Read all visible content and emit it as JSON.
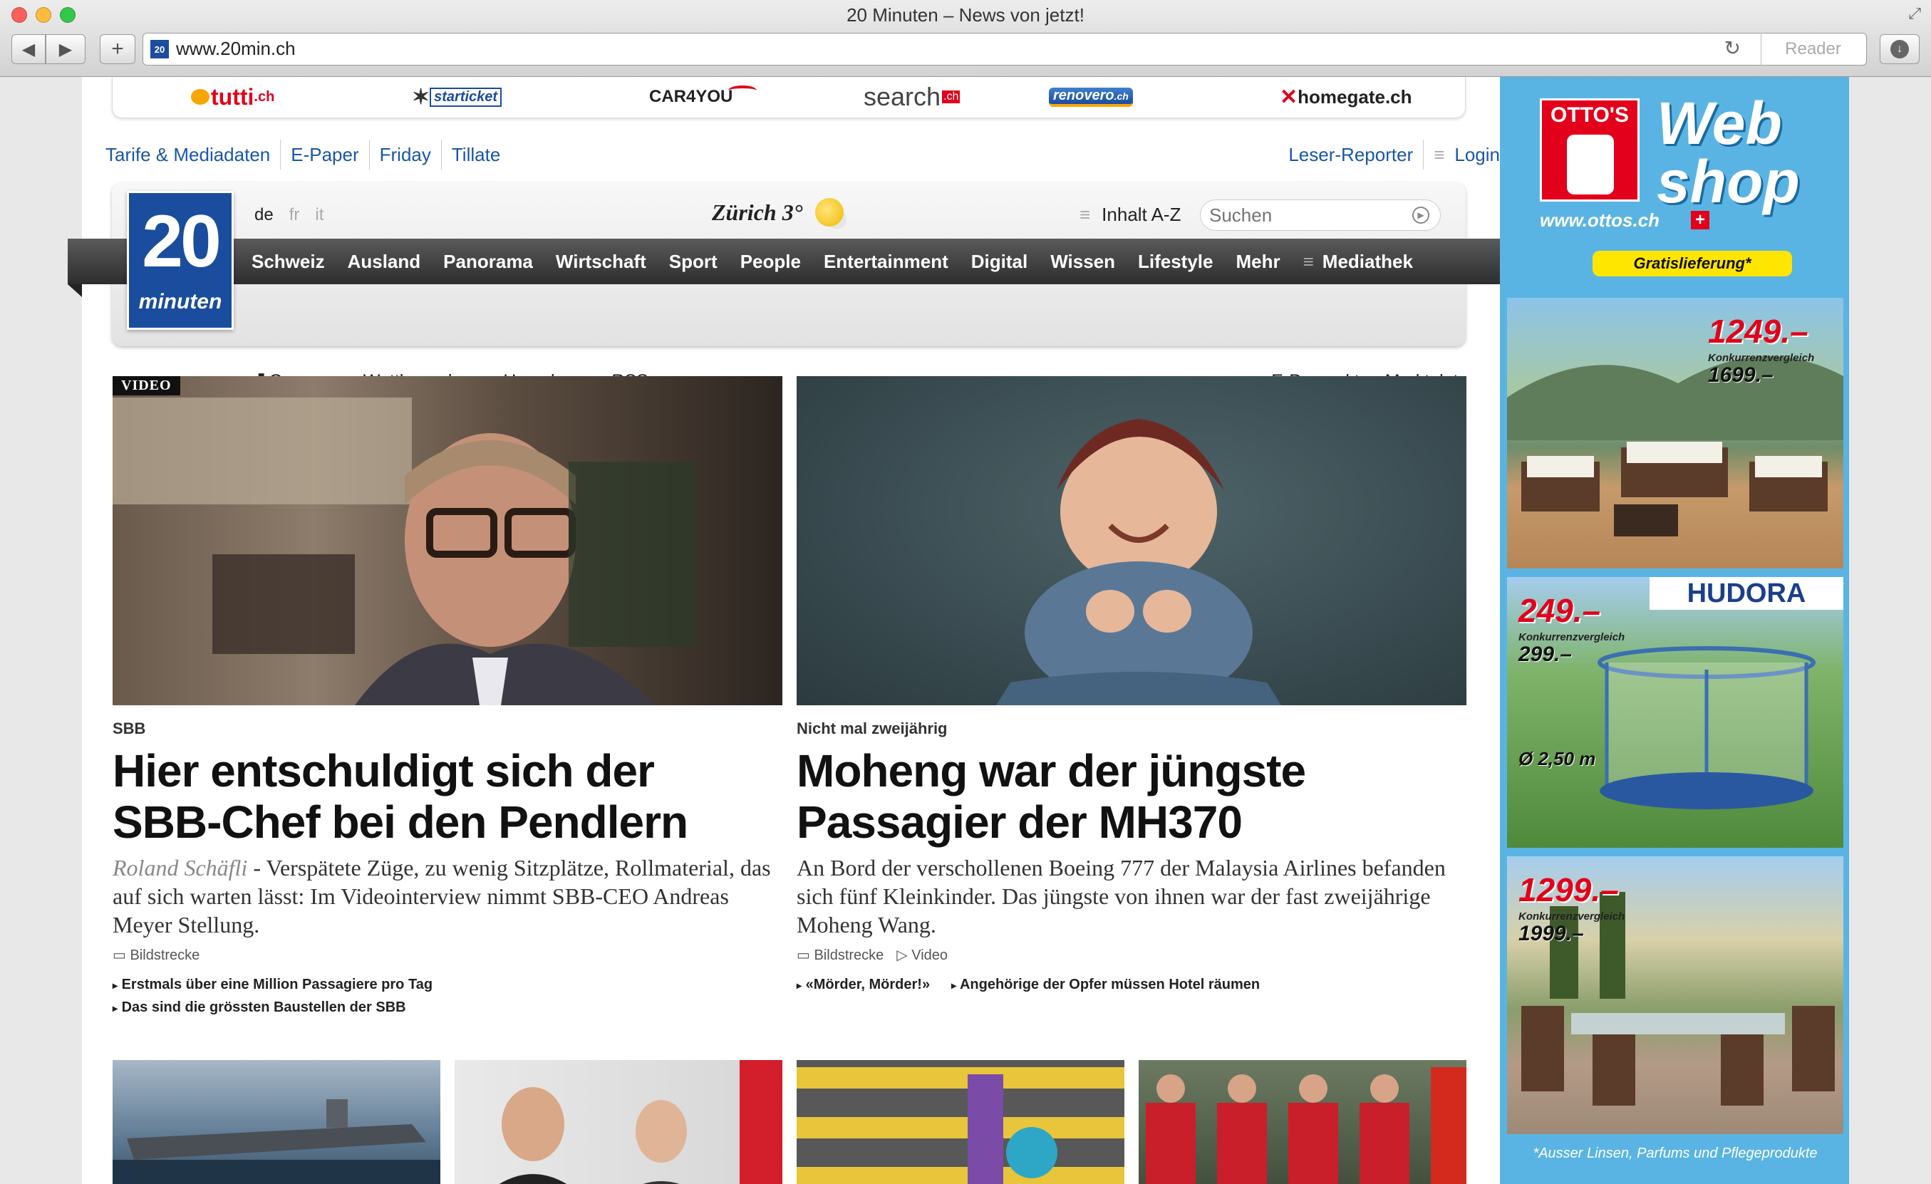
{
  "browser": {
    "window_title": "20 Minuten – News von jetzt!",
    "url": "www.20min.ch",
    "reader_label": "Reader",
    "colors": {
      "close": "#fc605b",
      "minimize": "#fdbc40",
      "zoom": "#34c84a"
    }
  },
  "partners": [
    {
      "name": "tutti",
      "suffix": ".ch",
      "color": "#e2001a"
    },
    {
      "name": "starticket",
      "suffix": "",
      "color": "#1b4c9f"
    },
    {
      "name": "CAR4YOU",
      "suffix": "",
      "color": "#222222"
    },
    {
      "name": "search",
      "suffix": ".ch",
      "color": "#444444"
    },
    {
      "name": "renovero",
      "suffix": ".ch",
      "color": "#ffffff"
    },
    {
      "name": "homegate",
      "suffix": ".ch",
      "color": "#222222"
    }
  ],
  "top_links": [
    "Tarife & Mediadaten",
    "E-Paper",
    "Friday",
    "Tillate"
  ],
  "right_links": {
    "reporter": "Leser-Reporter",
    "login": "Login"
  },
  "header": {
    "logo_number": "20",
    "logo_word": "minuten",
    "languages": [
      "de",
      "fr",
      "it"
    ],
    "weather_city": "Zürich",
    "weather_temp": "3°",
    "index_label": "Inhalt A-Z",
    "search_placeholder": "Suchen"
  },
  "main_nav": [
    "Schweiz",
    "Ausland",
    "Panorama",
    "Wirtschaft",
    "Sport",
    "People",
    "Entertainment",
    "Digital",
    "Wissen",
    "Lifestyle",
    "Mehr",
    "Mediathek"
  ],
  "sub_nav_left": [
    "Games",
    "Wettbewerbe",
    "Horoskop",
    "RSS"
  ],
  "sub_nav_right": [
    "E-Prospekte",
    "Marktplatz"
  ],
  "teasers": [
    {
      "badge": "VIDEO",
      "kicker": "SBB",
      "headline_line1": "Hier entschuldigt sich der",
      "headline_line2": "SBB-Chef bei den Pendlern",
      "author": "Roland Schäfli",
      "lead": " - Verspätete Züge, zu wenig Sitzplätze, Rollmaterial, das auf sich warten lässt: Im Videointerview nimmt SBB-CEO Andreas Meyer Stellung.",
      "meta": [
        "Bildstrecke"
      ],
      "related": [
        "Erstmals über eine Million Passagiere pro Tag",
        "Das sind die grössten Baustellen der SBB"
      ]
    },
    {
      "kicker": "Nicht mal zweijährig",
      "headline_line1": "Moheng war der jüngste",
      "headline_line2": "Passagier der MH370",
      "lead": "An Bord der verschollenen Boeing 777 der Malaysia Airlines befanden sich fünf Kleinkinder. Das jüngste von ihnen war der fast zweijährige Moheng Wang.",
      "meta": [
        "Bildstrecke",
        "Video"
      ],
      "related": [
        "«Mörder, Mörder!»",
        "Angehörige der Opfer müssen Hotel räumen"
      ]
    }
  ],
  "ad": {
    "otto": "OTTO'S",
    "webshop_line1": "Web",
    "webshop_line2": "shop",
    "url": "www.ottos.ch",
    "flag": "+",
    "free": "Gratislieferung*",
    "panels": [
      {
        "price": "1249.–",
        "compare": "Konkurrenzvergleich",
        "old": "1699.–"
      },
      {
        "brand": "HUDORA",
        "price": "249.–",
        "compare": "Konkurrenzvergleich",
        "old": "299.–",
        "size": "Ø 2,50 m"
      },
      {
        "price": "1299.–",
        "compare": "Konkurrenzvergleich",
        "old": "1999.–"
      }
    ],
    "footnote": "*Ausser Linsen, Parfums und Pflegeprodukte"
  }
}
